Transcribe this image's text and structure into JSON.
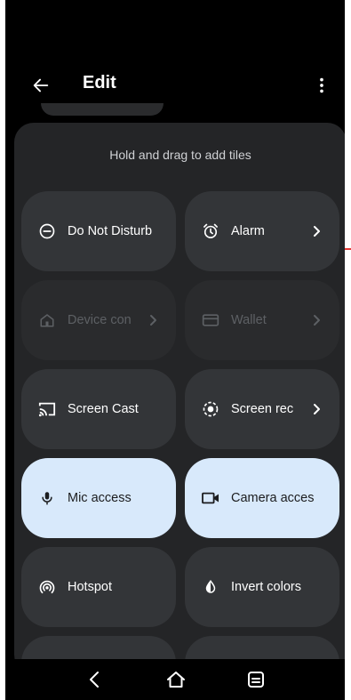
{
  "app": {
    "title": "Edit"
  },
  "hint": "Hold and drag to add tiles",
  "tiles": [
    {
      "label": "Do Not Disturb",
      "icon": "do-not-disturb-icon"
    },
    {
      "label": "Alarm",
      "icon": "alarm-icon"
    },
    {
      "label": "Device con",
      "icon": "home-icon"
    },
    {
      "label": "Wallet",
      "icon": "wallet-icon"
    },
    {
      "label": "Screen Cast",
      "icon": "cast-icon"
    },
    {
      "label": "Screen rec",
      "icon": "record-icon"
    },
    {
      "label": "Mic access",
      "icon": "microphone-icon"
    },
    {
      "label": "Camera acces",
      "icon": "camera-icon"
    },
    {
      "label": "Hotspot",
      "icon": "hotspot-icon"
    },
    {
      "label": "Invert colors",
      "icon": "invert-colors-icon"
    }
  ],
  "colors": {
    "background": "#000000",
    "panel": "#242527",
    "tile": "#333538",
    "tile_dim": "#2a2b2d",
    "tile_active": "#d8e9fb"
  }
}
